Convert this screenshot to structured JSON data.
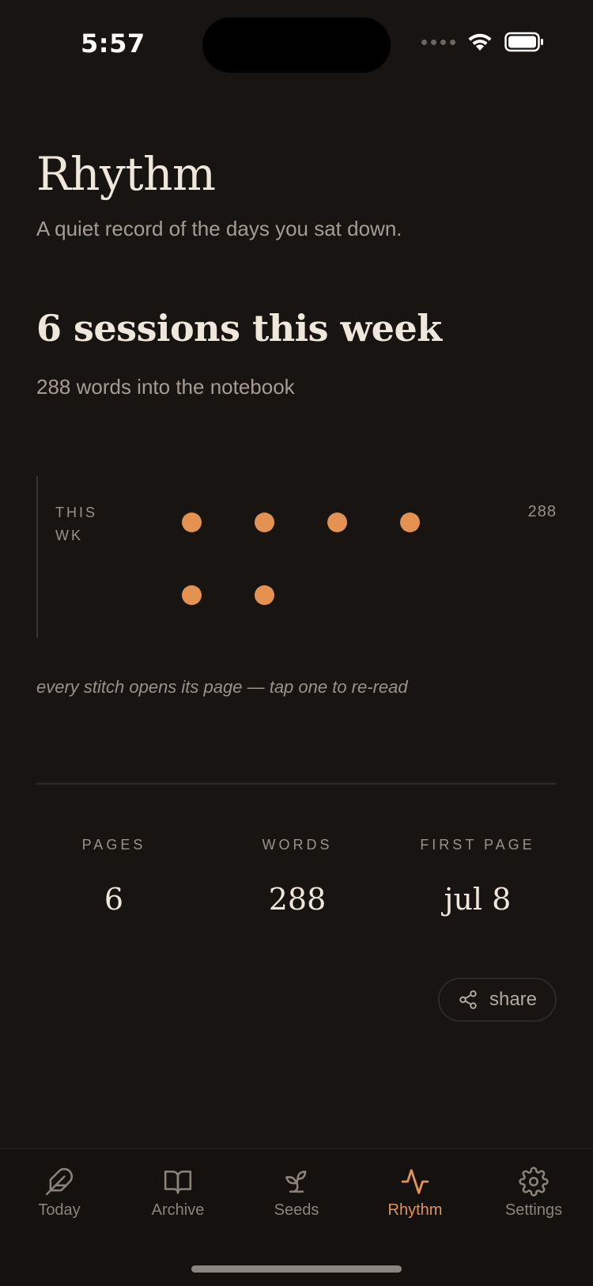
{
  "status_bar": {
    "time": "5:57"
  },
  "header": {
    "title": "Rhythm",
    "subtitle": "A quiet record of the days you sat down."
  },
  "week": {
    "heading": "6 sessions this week",
    "words_line": "288 words into the notebook"
  },
  "stitches": {
    "row_label": "THIS WK",
    "word_count": "288",
    "sessions": 6,
    "dot_color": "#e39252",
    "hint": "every stitch opens its page — tap one to re-read"
  },
  "stats": [
    {
      "label": "PAGES",
      "value": "6"
    },
    {
      "label": "WORDS",
      "value": "288"
    },
    {
      "label": "FIRST PAGE",
      "value": "jul 8"
    }
  ],
  "share": {
    "label": "share",
    "icon": "share-icon"
  },
  "tabs": [
    {
      "label": "Today",
      "icon": "feather-icon",
      "active": false
    },
    {
      "label": "Archive",
      "icon": "book-open-icon",
      "active": false
    },
    {
      "label": "Seeds",
      "icon": "sprout-icon",
      "active": false
    },
    {
      "label": "Rhythm",
      "icon": "activity-icon",
      "active": true
    },
    {
      "label": "Settings",
      "icon": "gear-icon",
      "active": false
    }
  ],
  "colors": {
    "background": "#181411",
    "accent": "#e39252",
    "text": "#efe7db",
    "muted": "#9a9289"
  }
}
